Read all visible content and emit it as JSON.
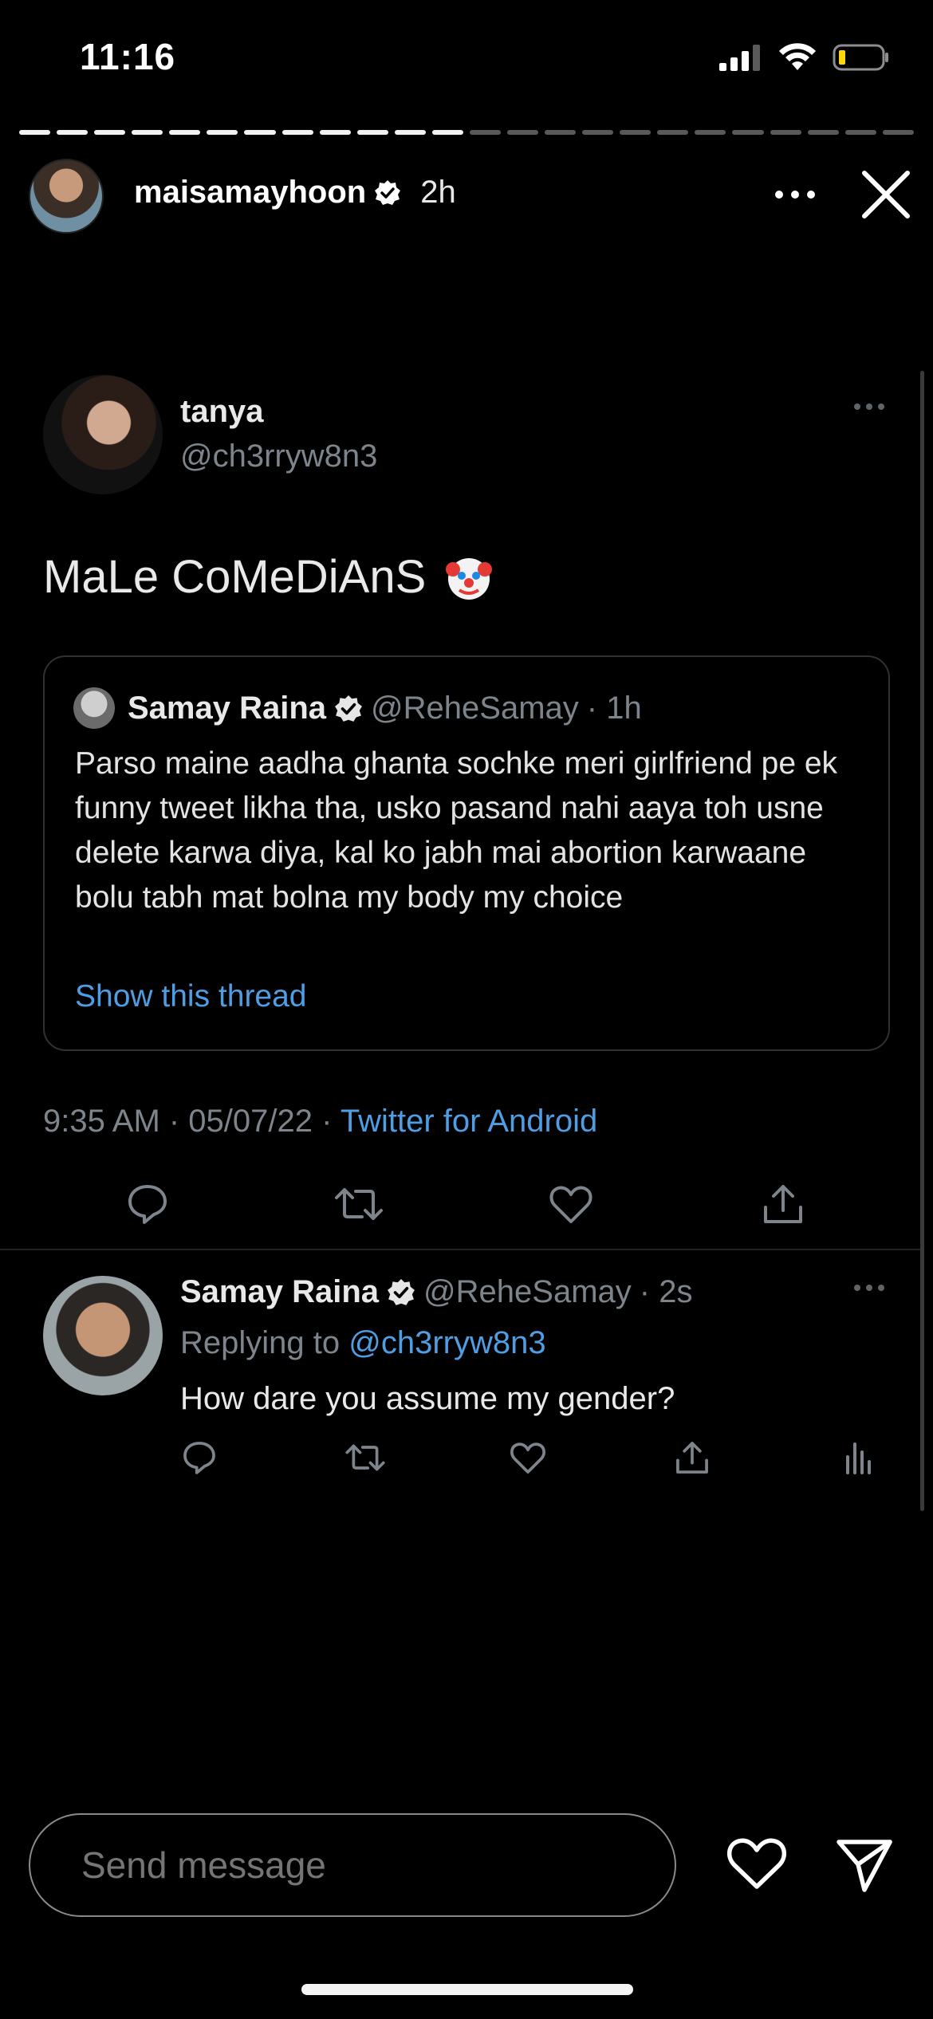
{
  "status_bar": {
    "time": "11:16"
  },
  "story": {
    "username": "maisamayhoon",
    "time_ago": "2h",
    "progress": {
      "segments": 24,
      "completed": 12
    }
  },
  "tweet": {
    "name": "tanya",
    "handle": "@ch3rryw8n3",
    "text": "MaLe CoMeDiAnS",
    "quoted": {
      "name": "Samay Raina",
      "handle": "@ReheSamay",
      "time": "· 1h",
      "text": "Parso maine aadha ghanta sochke meri girlfriend pe ek funny tweet likha tha, usko pasand nahi aaya toh usne delete karwa diya, kal ko jabh mai abortion karwaane bolu tabh mat bolna my body my choice",
      "show_thread": "Show this thread"
    },
    "timestamp": "9:35 AM · 05/07/22 ·",
    "source": "Twitter for Android"
  },
  "reply": {
    "name": "Samay Raina",
    "handle": "@ReheSamay",
    "time": "· 2s",
    "replying_to_label": "Replying to",
    "replying_to": "@ch3rryw8n3",
    "text": "How dare you assume my gender?"
  },
  "composer": {
    "placeholder": "Send message"
  },
  "colors": {
    "link": "#4f9de3",
    "muted": "#7d848b",
    "background": "#000000"
  }
}
